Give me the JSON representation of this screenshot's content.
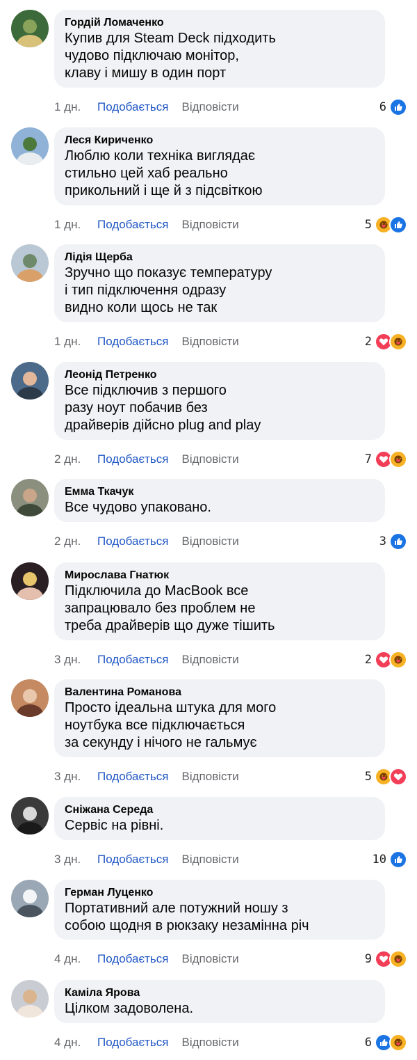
{
  "actions": {
    "like_label": "Подобається",
    "reply_label": "Відповісти"
  },
  "colors": {
    "link": "#1f56c4",
    "meta": "#65676b",
    "bubble": "#f0f2f5",
    "like": "#1b74e4",
    "love": "#f33e58",
    "care": "#f7b125"
  },
  "comments": [
    {
      "author": "Гордій Ломаченко",
      "text": "Купив для Steam Deck підходить\nчудово підключаю монітор,\nклаву і мишу в один порт",
      "time": "1 дн.",
      "reaction_count": "6",
      "reactions": [
        "like-icon"
      ],
      "avatar_colors": [
        "#3c6a3a",
        "#8aa35a",
        "#d8c27a"
      ]
    },
    {
      "author": "Леся Кириченко",
      "text": "Люблю коли техніка виглядає\nстильно цей хаб реально\nприкольний і ще й з підсвіткою",
      "time": "1 дн.",
      "reaction_count": "5",
      "reactions": [
        "care-icon",
        "like-icon"
      ],
      "avatar_colors": [
        "#8fb2d6",
        "#4d7a3c",
        "#e9edf0"
      ]
    },
    {
      "author": "Лідія Щерба",
      "text": "Зручно що показує температуру\nі тип підключення одразу\nвидно коли щось не так",
      "time": "1 дн.",
      "reaction_count": "2",
      "reactions": [
        "love-icon",
        "care-icon"
      ],
      "avatar_colors": [
        "#b9c8d4",
        "#6f8a6a",
        "#d9a06a"
      ]
    },
    {
      "author": "Леонід Петренко",
      "text": "Все підключив з першого\nразу ноут побачив без\nдрайверів дійсно plug and play",
      "time": "2 дн.",
      "reaction_count": "7",
      "reactions": [
        "love-icon",
        "care-icon"
      ],
      "avatar_colors": [
        "#4c6a8a",
        "#e2b79a",
        "#2d3a4a"
      ]
    },
    {
      "author": "Емма Ткачук",
      "text": "Все чудово упаковано.",
      "time": "2 дн.",
      "reaction_count": "3",
      "reactions": [
        "like-icon"
      ],
      "avatar_colors": [
        "#8a8f7e",
        "#c9a58a",
        "#3f4a3a"
      ]
    },
    {
      "author": "Мирослава Гнатюк",
      "text": "Підключила до MacBook все\nзапрацювало без проблем не\nтреба драйверів що дуже тішить",
      "time": "3 дн.",
      "reaction_count": "2",
      "reactions": [
        "love-icon",
        "care-icon"
      ],
      "avatar_colors": [
        "#2a1f22",
        "#e7c56a",
        "#e4bfae"
      ]
    },
    {
      "author": "Валентина Романова",
      "text": "Просто ідеальна штука для мого\nноутбука все підключається\nза секунду і нічого не гальмує",
      "time": "3 дн.",
      "reaction_count": "5",
      "reactions": [
        "care-icon",
        "love-icon"
      ],
      "avatar_colors": [
        "#c58a62",
        "#e9c7ad",
        "#6a3a2a"
      ]
    },
    {
      "author": "Сніжана Середа",
      "text": "Сервіс на рівні.",
      "time": "3 дн.",
      "reaction_count": "10",
      "reactions": [
        "like-icon"
      ],
      "avatar_colors": [
        "#3a3a3a",
        "#d9d9d9",
        "#1a1a1a"
      ]
    },
    {
      "author": "Герман Луценко",
      "text": "Портативний але потужний ношу з\nсобою щодня в рюкзаку незамінна річ",
      "time": "4 дн.",
      "reaction_count": "9",
      "reactions": [
        "love-icon",
        "care-icon"
      ],
      "avatar_colors": [
        "#9aa7b4",
        "#f2f4f6",
        "#4a5560"
      ]
    },
    {
      "author": "Каміла Ярова",
      "text": "Цілком задоволена.",
      "time": "4 дн.",
      "reaction_count": "6",
      "reactions": [
        "like-icon",
        "care-icon"
      ],
      "avatar_colors": [
        "#c9ccd2",
        "#d9b48c",
        "#f1e6dc"
      ]
    }
  ]
}
